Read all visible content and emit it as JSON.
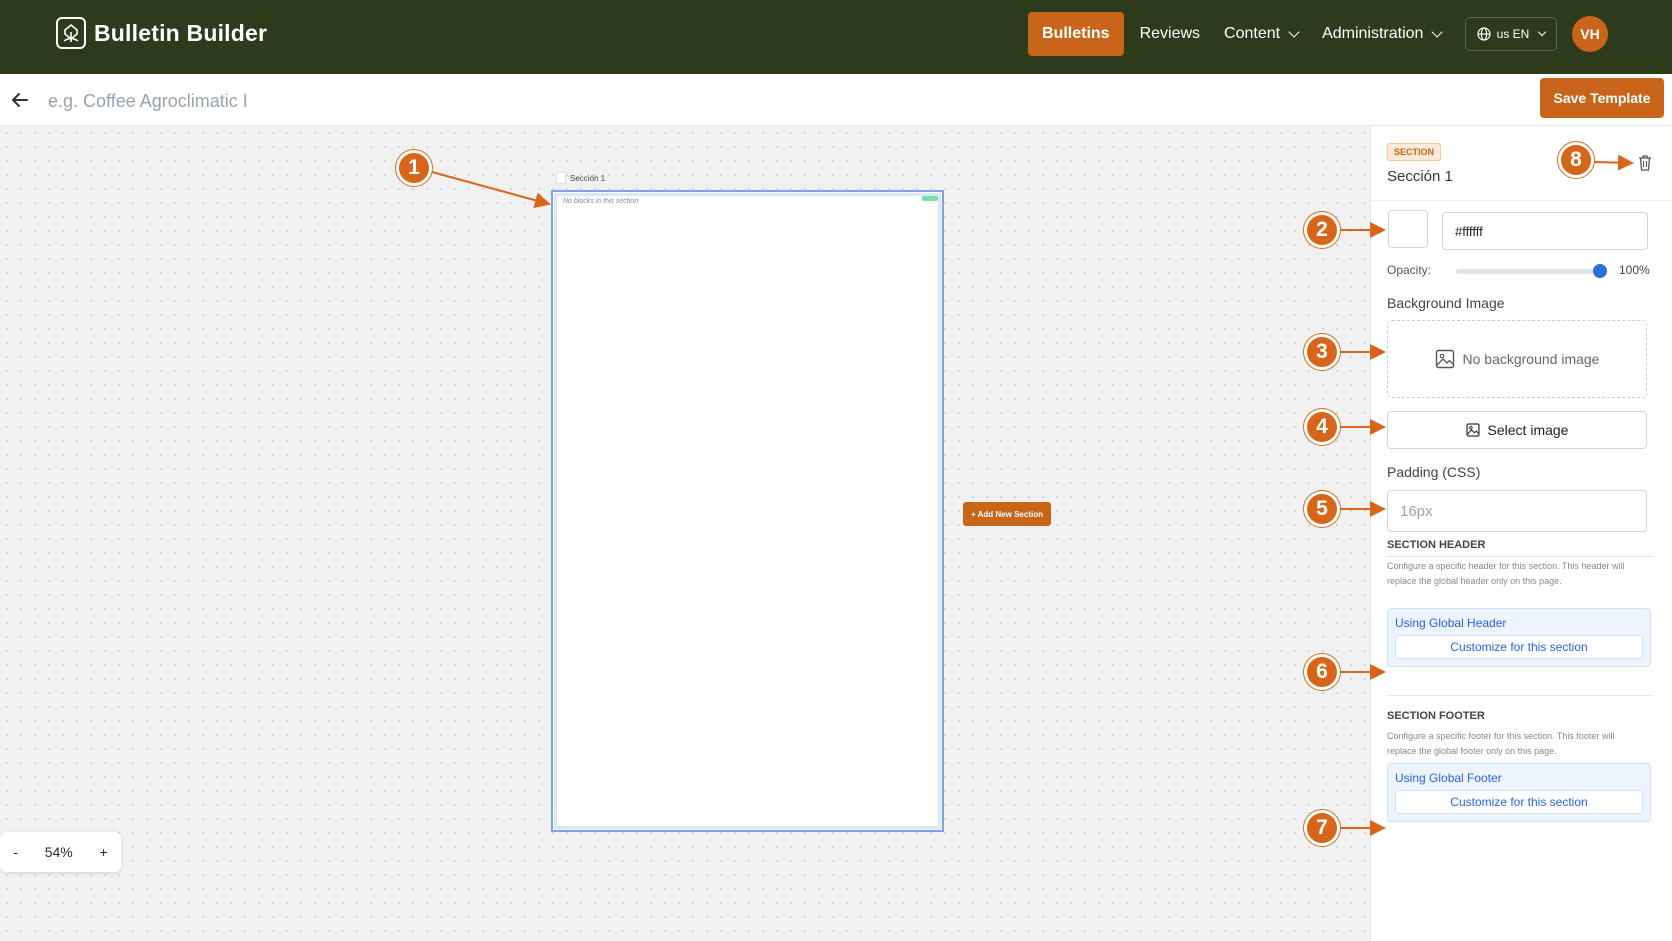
{
  "app": {
    "name": "Bulletin Builder"
  },
  "nav": {
    "items": [
      {
        "label": "Bulletins",
        "active": true
      },
      {
        "label": "Reviews",
        "active": false
      },
      {
        "label": "Content",
        "dropdown": true
      },
      {
        "label": "Administration",
        "dropdown": true
      }
    ],
    "language": "us EN",
    "avatar_initials": "VH"
  },
  "toolbar": {
    "title_placeholder": "e.g. Coffee Agroclimatic I",
    "save_label": "Save Template"
  },
  "canvas": {
    "section_label": "Sección 1",
    "empty_message": "No blocks in this section",
    "add_section_label": "+ Add New Section",
    "zoom": {
      "minus": "-",
      "value": "54%",
      "plus": "+"
    }
  },
  "callouts": [
    "1",
    "2",
    "3",
    "4",
    "5",
    "6",
    "7",
    "8"
  ],
  "panel": {
    "badge": "SECTION",
    "title": "Sección 1",
    "color": {
      "value": "#ffffff",
      "swatch": "#ffffff"
    },
    "opacity": {
      "label": "Opacity:",
      "value": "100%",
      "level": 1.0
    },
    "background_image": {
      "label": "Background Image",
      "empty": "No background image",
      "select_label": "Select image"
    },
    "padding": {
      "label": "Padding (CSS)",
      "placeholder": "16px"
    },
    "section_header": {
      "title": "SECTION HEADER",
      "description": "Configure a specific header for this section. This header will replace the global header only on this page.",
      "status": "Using Global Header",
      "button": "Customize for this section"
    },
    "section_footer": {
      "title": "SECTION FOOTER",
      "description": "Configure a specific footer for this section. This footer will replace the global footer only on this page.",
      "status": "Using Global Footer",
      "button": "Customize for this section"
    }
  },
  "colors": {
    "nav_bg": "#2d3a1c",
    "accent": "#c8651a",
    "callout": "#d8661a",
    "link_blue": "#2563eb"
  }
}
